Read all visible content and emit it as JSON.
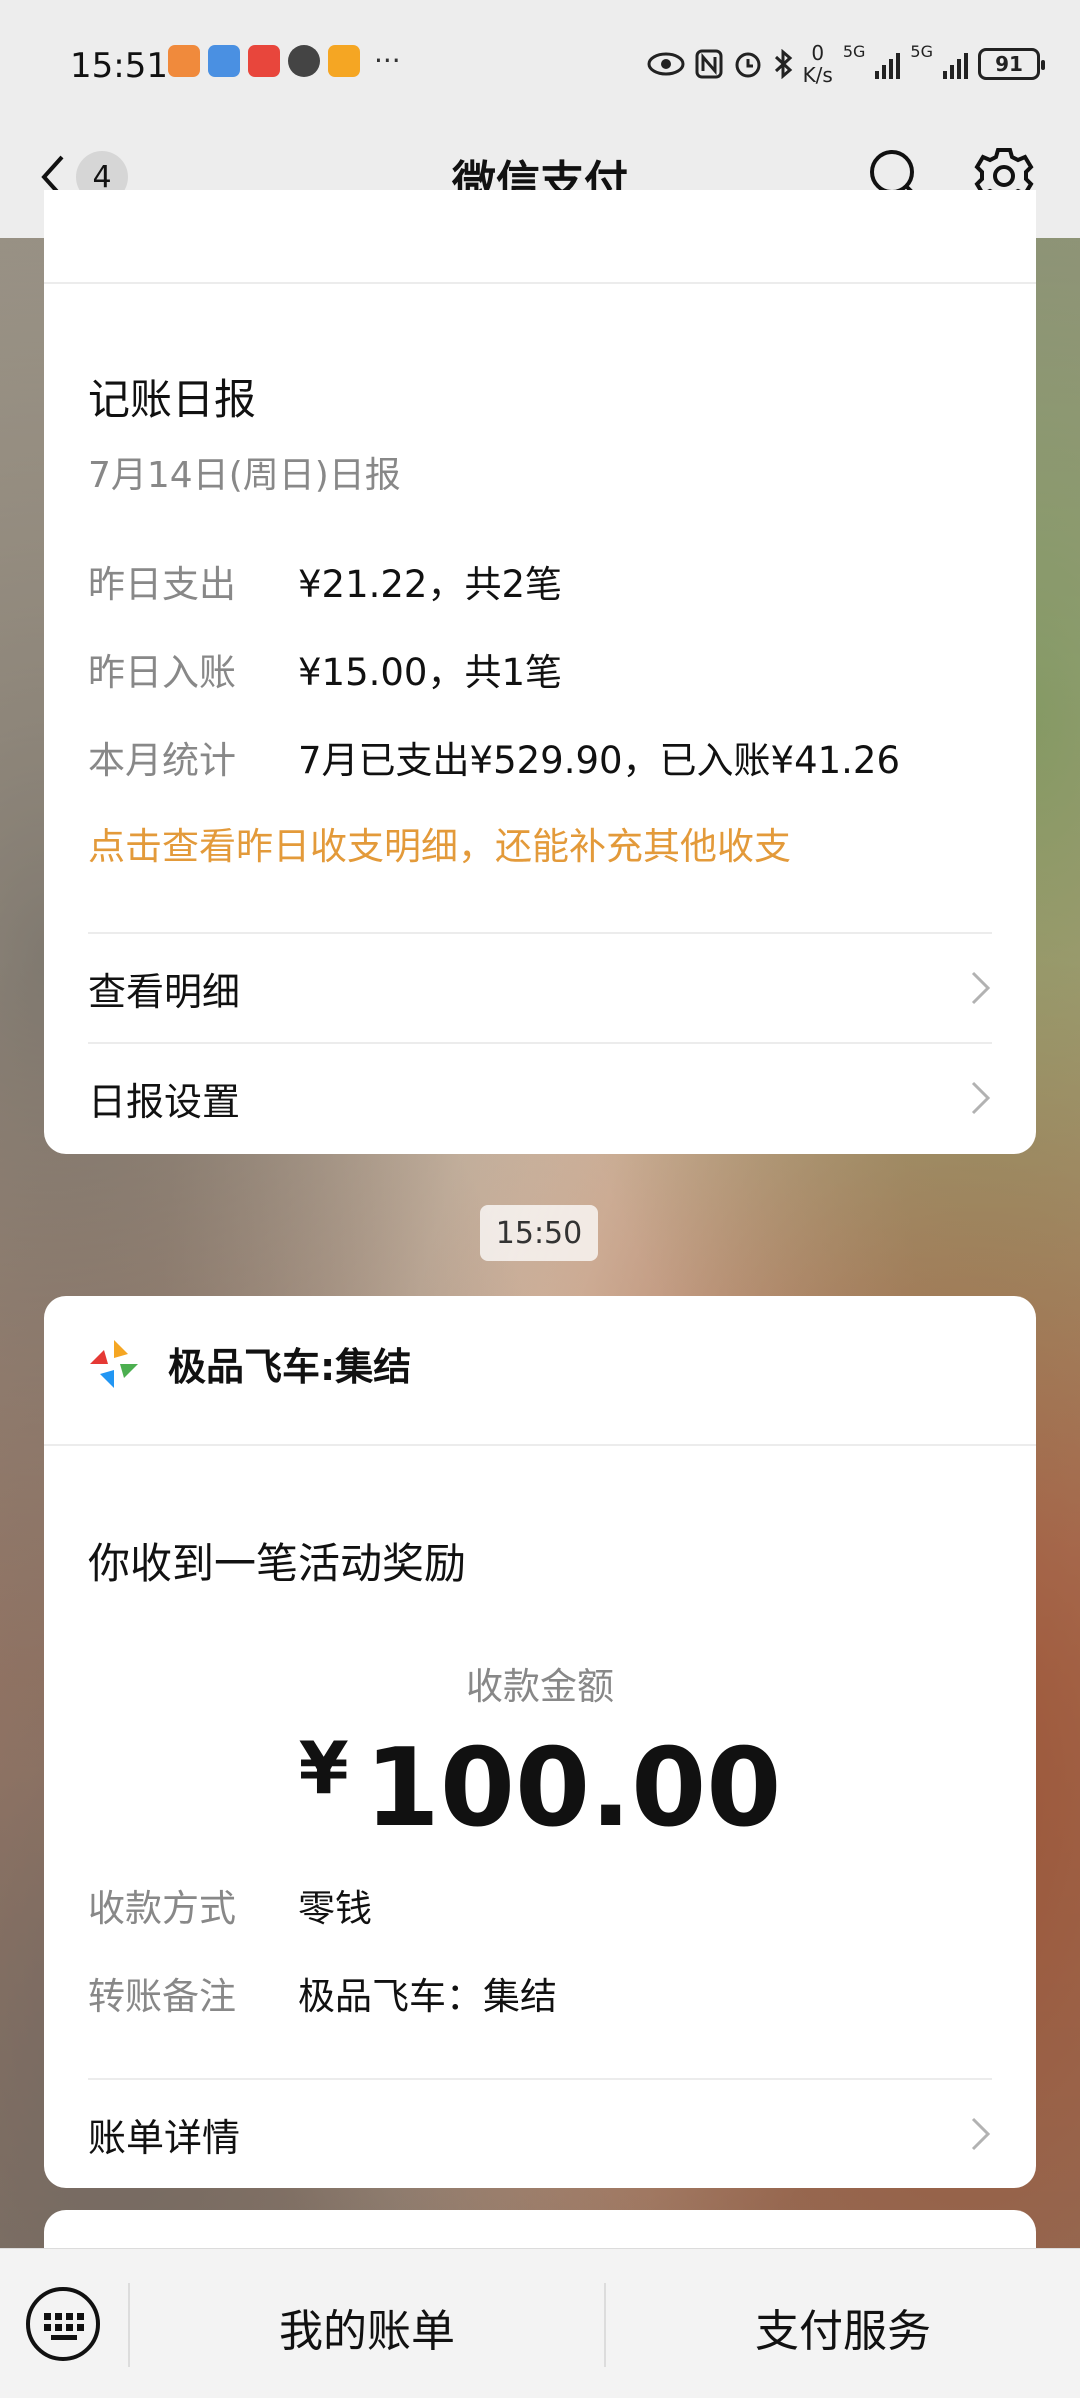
{
  "status_bar": {
    "time": "15:51",
    "speed_value": "0",
    "speed_unit": "K/s",
    "net1": "5G",
    "net2": "5G",
    "battery": "91",
    "more": "···"
  },
  "nav": {
    "back_count": "4",
    "title": "微信支付"
  },
  "report_card": {
    "title": "记账日报",
    "subtitle": "7月14日(周日)日报",
    "rows": [
      {
        "label": "昨日支出",
        "value": "¥21.22，共2笔"
      },
      {
        "label": "昨日入账",
        "value": "¥15.00，共1笔"
      },
      {
        "label": "本月统计",
        "value": "7月已支出¥529.90，已入账¥41.26"
      }
    ],
    "hint": "点击查看昨日收支明细，还能补充其他收支",
    "link_detail": "查看明细",
    "link_settings": "日报设置"
  },
  "time_chip": "15:50",
  "payment_card": {
    "app_name": "极品飞车:集结",
    "title": "你收到一笔活动奖励",
    "amount_label": "收款金额",
    "currency": "¥",
    "amount": "100.00",
    "rows": [
      {
        "label": "收款方式",
        "value": "零钱"
      },
      {
        "label": "转账备注",
        "value": "极品飞车：集结"
      }
    ],
    "link_bill": "账单详情"
  },
  "bottom_bar": {
    "tab_bills": "我的账单",
    "tab_services": "支付服务"
  },
  "colors": {
    "accent_orange": "#e39a3a",
    "bar_bg": "#ededed"
  }
}
